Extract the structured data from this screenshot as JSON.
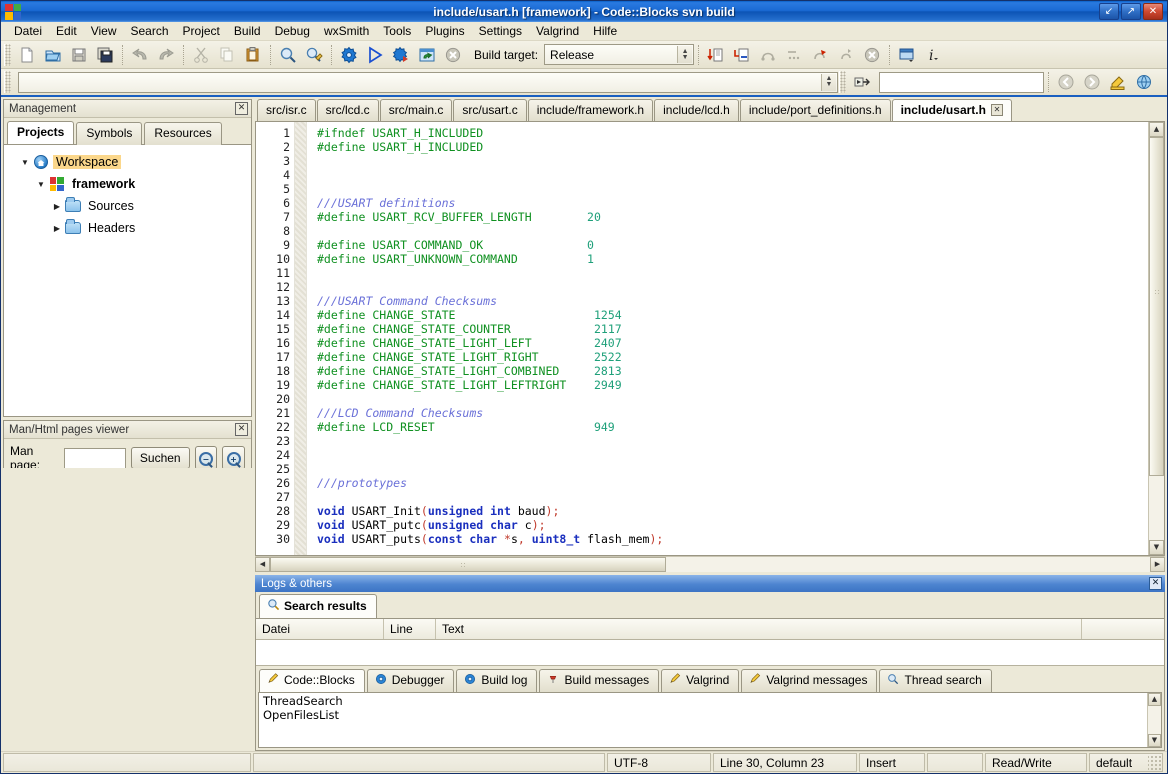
{
  "window": {
    "title": "include/usart.h [framework] - Code::Blocks svn build",
    "minimize_label": "↙",
    "maximize_label": "↗",
    "close_label": "✕"
  },
  "menubar": {
    "items": [
      {
        "label": "Datei"
      },
      {
        "label": "Edit"
      },
      {
        "label": "View"
      },
      {
        "label": "Search"
      },
      {
        "label": "Project"
      },
      {
        "label": "Build"
      },
      {
        "label": "Debug"
      },
      {
        "label": "wxSmith"
      },
      {
        "label": "Tools"
      },
      {
        "label": "Plugins"
      },
      {
        "label": "Settings"
      },
      {
        "label": "Valgrind"
      },
      {
        "label": "Hilfe"
      }
    ]
  },
  "toolbar": {
    "build_target_label": "Build target:",
    "build_target_value": "Release",
    "scope_value": "",
    "search_value": "",
    "icons": [
      "new-file-icon",
      "open-file-icon",
      "save-icon",
      "save-all-icon",
      "undo-icon",
      "redo-icon",
      "cut-icon",
      "copy-icon",
      "paste-icon",
      "find-icon",
      "find-replace-icon",
      "build-icon",
      "run-icon",
      "build-and-run-icon",
      "rebuild-icon",
      "abort-icon",
      "debug-continue-icon",
      "debug-run-to-cursor-icon",
      "debug-next-line-icon",
      "debug-step-into-icon",
      "debug-step-out-icon",
      "debug-next-instruction-icon",
      "debug-stop-icon",
      "debug-windows-icon",
      "debug-info-icon",
      "goto-declaration-icon",
      "back-icon",
      "forward-icon",
      "highlight-icon",
      "globe-icon"
    ]
  },
  "management": {
    "caption": "Management",
    "close_label": "✕",
    "tabs": [
      {
        "label": "Projects",
        "active": true
      },
      {
        "label": "Symbols",
        "active": false
      },
      {
        "label": "Resources",
        "active": false
      }
    ],
    "tree": [
      {
        "label": "Workspace",
        "kind": "workspace",
        "selected": true
      },
      {
        "label": "framework",
        "kind": "project",
        "bold": true
      },
      {
        "label": "Sources",
        "kind": "folder"
      },
      {
        "label": "Headers",
        "kind": "folder"
      }
    ]
  },
  "manviewer": {
    "caption": "Man/Html pages viewer",
    "close_label": "✕",
    "field_label": "Man page:",
    "field_value": "",
    "search_button": "Suchen",
    "zoom_out_label": "−",
    "zoom_in_label": "+"
  },
  "editor": {
    "tabs": [
      {
        "label": "src/isr.c",
        "active": false
      },
      {
        "label": "src/lcd.c",
        "active": false
      },
      {
        "label": "src/main.c",
        "active": false
      },
      {
        "label": "src/usart.c",
        "active": false
      },
      {
        "label": "include/framework.h",
        "active": false
      },
      {
        "label": "include/lcd.h",
        "active": false
      },
      {
        "label": "include/port_definitions.h",
        "active": false
      },
      {
        "label": "include/usart.h",
        "active": true
      }
    ],
    "close_tab_label": "✕",
    "first_line": 1,
    "lines": [
      {
        "n": 1,
        "tokens": [
          {
            "t": "#ifndef USART_H_INCLUDED",
            "c": "pp"
          }
        ]
      },
      {
        "n": 2,
        "tokens": [
          {
            "t": "#define USART_H_INCLUDED",
            "c": "pp"
          }
        ]
      },
      {
        "n": 3,
        "tokens": []
      },
      {
        "n": 4,
        "tokens": []
      },
      {
        "n": 5,
        "tokens": []
      },
      {
        "n": 6,
        "tokens": [
          {
            "t": "///USART definitions",
            "c": "cmt"
          }
        ]
      },
      {
        "n": 7,
        "tokens": [
          {
            "t": "#define USART_RCV_BUFFER_LENGTH",
            "c": "pp"
          },
          {
            "t": "        ",
            "c": "id"
          },
          {
            "t": "20",
            "c": "num"
          }
        ]
      },
      {
        "n": 8,
        "tokens": []
      },
      {
        "n": 9,
        "tokens": [
          {
            "t": "#define USART_COMMAND_OK",
            "c": "pp"
          },
          {
            "t": "               ",
            "c": "id"
          },
          {
            "t": "0",
            "c": "num"
          }
        ]
      },
      {
        "n": 10,
        "tokens": [
          {
            "t": "#define USART_UNKNOWN_COMMAND",
            "c": "pp"
          },
          {
            "t": "          ",
            "c": "id"
          },
          {
            "t": "1",
            "c": "num"
          }
        ]
      },
      {
        "n": 11,
        "tokens": []
      },
      {
        "n": 12,
        "tokens": []
      },
      {
        "n": 13,
        "tokens": [
          {
            "t": "///USART Command Checksums",
            "c": "cmt"
          }
        ]
      },
      {
        "n": 14,
        "tokens": [
          {
            "t": "#define CHANGE_STATE",
            "c": "pp"
          },
          {
            "t": "                    ",
            "c": "id"
          },
          {
            "t": "1254",
            "c": "num"
          }
        ]
      },
      {
        "n": 15,
        "tokens": [
          {
            "t": "#define CHANGE_STATE_COUNTER",
            "c": "pp"
          },
          {
            "t": "            ",
            "c": "id"
          },
          {
            "t": "2117",
            "c": "num"
          }
        ]
      },
      {
        "n": 16,
        "tokens": [
          {
            "t": "#define CHANGE_STATE_LIGHT_LEFT",
            "c": "pp"
          },
          {
            "t": "         ",
            "c": "id"
          },
          {
            "t": "2407",
            "c": "num"
          }
        ]
      },
      {
        "n": 17,
        "tokens": [
          {
            "t": "#define CHANGE_STATE_LIGHT_RIGHT",
            "c": "pp"
          },
          {
            "t": "        ",
            "c": "id"
          },
          {
            "t": "2522",
            "c": "num"
          }
        ]
      },
      {
        "n": 18,
        "tokens": [
          {
            "t": "#define CHANGE_STATE_LIGHT_COMBINED",
            "c": "pp"
          },
          {
            "t": "     ",
            "c": "id"
          },
          {
            "t": "2813",
            "c": "num"
          }
        ]
      },
      {
        "n": 19,
        "tokens": [
          {
            "t": "#define CHANGE_STATE_LIGHT_LEFTRIGHT",
            "c": "pp"
          },
          {
            "t": "    ",
            "c": "id"
          },
          {
            "t": "2949",
            "c": "num"
          }
        ]
      },
      {
        "n": 20,
        "tokens": []
      },
      {
        "n": 21,
        "tokens": [
          {
            "t": "///LCD Command Checksums",
            "c": "cmt"
          }
        ]
      },
      {
        "n": 22,
        "tokens": [
          {
            "t": "#define LCD_RESET",
            "c": "pp"
          },
          {
            "t": "                       ",
            "c": "id"
          },
          {
            "t": "949",
            "c": "num"
          }
        ]
      },
      {
        "n": 23,
        "tokens": []
      },
      {
        "n": 24,
        "tokens": []
      },
      {
        "n": 25,
        "tokens": []
      },
      {
        "n": 26,
        "tokens": [
          {
            "t": "///prototypes",
            "c": "cmt"
          }
        ]
      },
      {
        "n": 27,
        "tokens": []
      },
      {
        "n": 28,
        "tokens": [
          {
            "t": "void",
            "c": "kw"
          },
          {
            "t": " USART_Init",
            "c": "id"
          },
          {
            "t": "(",
            "c": "op"
          },
          {
            "t": "unsigned int",
            "c": "kw"
          },
          {
            "t": " baud",
            "c": "id"
          },
          {
            "t": ");",
            "c": "op"
          }
        ]
      },
      {
        "n": 29,
        "tokens": [
          {
            "t": "void",
            "c": "kw"
          },
          {
            "t": " USART_putc",
            "c": "id"
          },
          {
            "t": "(",
            "c": "op"
          },
          {
            "t": "unsigned char",
            "c": "kw"
          },
          {
            "t": " c",
            "c": "id"
          },
          {
            "t": ");",
            "c": "op"
          }
        ]
      },
      {
        "n": 30,
        "tokens": [
          {
            "t": "void",
            "c": "kw"
          },
          {
            "t": " USART_puts",
            "c": "id"
          },
          {
            "t": "(",
            "c": "op"
          },
          {
            "t": "const char",
            "c": "kw"
          },
          {
            "t": " ",
            "c": "id"
          },
          {
            "t": "*",
            "c": "op"
          },
          {
            "t": "s",
            "c": "id"
          },
          {
            "t": ", ",
            "c": "op"
          },
          {
            "t": "uint8_t",
            "c": "kw"
          },
          {
            "t": " flash_mem",
            "c": "id"
          },
          {
            "t": ");",
            "c": "op"
          }
        ]
      }
    ]
  },
  "logs": {
    "caption": "Logs & others",
    "close_label": "✕",
    "search_results_tab": "Search results",
    "columns": [
      "Datei",
      "Line",
      "Text"
    ],
    "rows": [],
    "tabs": [
      {
        "label": "Code::Blocks",
        "icon": "pencil-icon",
        "active": true
      },
      {
        "label": "Debugger",
        "icon": "gear-icon",
        "active": false
      },
      {
        "label": "Build log",
        "icon": "gear-icon",
        "active": false
      },
      {
        "label": "Build messages",
        "icon": "pin-icon",
        "active": false
      },
      {
        "label": "Valgrind",
        "icon": "pencil-icon",
        "active": false
      },
      {
        "label": "Valgrind messages",
        "icon": "pencil-icon",
        "active": false
      },
      {
        "label": "Thread search",
        "icon": "magnifier-icon",
        "active": false
      }
    ],
    "output": [
      "ThreadSearch",
      "OpenFilesList"
    ]
  },
  "statusbar": {
    "fields": [
      "",
      "",
      "UTF-8",
      "Line 30, Column 23",
      "Insert",
      "",
      "Read/Write",
      "default"
    ]
  },
  "colors": {
    "titlebar": "#1a6ad4",
    "panel_active": "#4d84d0",
    "selection": "#fbd78b",
    "preprocessor": "#0f9020",
    "comment": "#6a70d8",
    "number": "#1fa07a",
    "keyword": "#1a2fbe",
    "operator": "#c0392b"
  }
}
